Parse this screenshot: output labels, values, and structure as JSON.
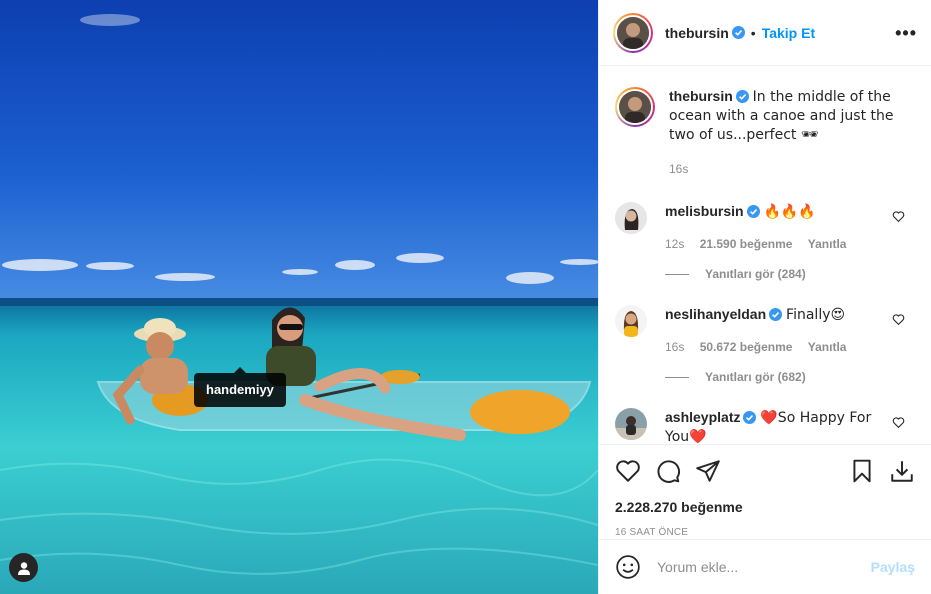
{
  "post": {
    "author": "thebursin",
    "follow_label": "Takip Et",
    "more_icon": "more-options-icon",
    "photo_tag": "handemiyy"
  },
  "caption": {
    "author": "thebursin",
    "text": "In the middle of the ocean with a canoe and just the two of us...perfect 🕶",
    "time": "16s"
  },
  "comments": [
    {
      "author": "melisbursin",
      "text": "🔥🔥🔥",
      "time": "12s",
      "likes": "21.590 beğenme",
      "reply_label": "Yanıtla",
      "view_replies": "Yanıtları gör (284)"
    },
    {
      "author": "neslihanyeldan",
      "text": "Finally😍",
      "time": "16s",
      "likes": "50.672 beğenme",
      "reply_label": "Yanıtla",
      "view_replies": "Yanıtları gör (682)"
    },
    {
      "author": "ashleyplatz",
      "text": "❤️So Happy For You❤️"
    }
  ],
  "actions": {
    "like_count": "2.228.270 beğenme",
    "time_ago": "16 SAAT ÖNCE"
  },
  "add_comment": {
    "placeholder": "Yorum ekle...",
    "post_label": "Paylaş"
  },
  "colors": {
    "accent": "#0095f6",
    "verified": "#3897f0",
    "muted": "#8e8e8e"
  }
}
